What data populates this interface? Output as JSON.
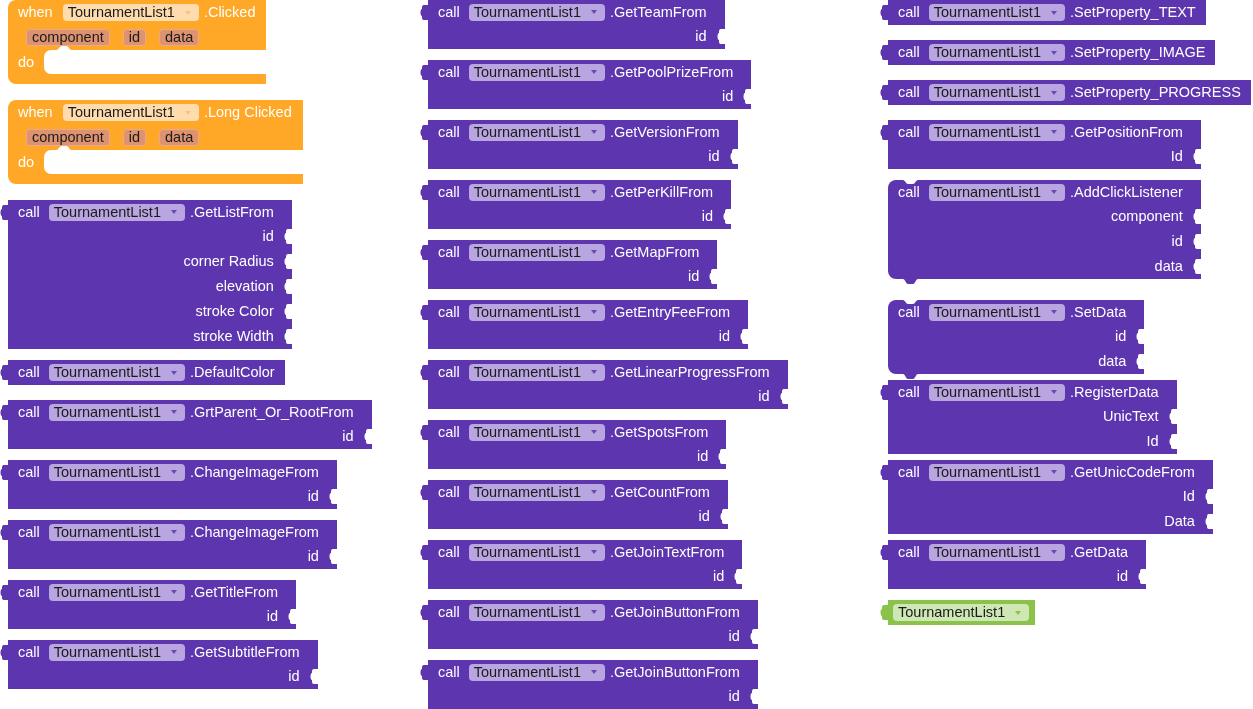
{
  "workspace": {
    "columns": [
      {
        "blocks": [
          {
            "kind": "event",
            "keyword": "when",
            "component": "TournamentList1",
            "event": ".Clicked",
            "params": [
              "component",
              "id",
              "data"
            ],
            "do_label": "do"
          },
          {
            "kind": "event",
            "keyword": "when",
            "component": "TournamentList1",
            "event": ".Long Clicked",
            "params": [
              "component",
              "id",
              "data"
            ],
            "do_label": "do"
          },
          {
            "kind": "value_call",
            "keyword": "call",
            "component": "TournamentList1",
            "method": ".GetListFrom",
            "inputs": [
              "id",
              "corner Radius",
              "elevation",
              "stroke Color",
              "stroke Width"
            ]
          },
          {
            "kind": "value_call",
            "keyword": "call",
            "component": "TournamentList1",
            "method": ".DefaultColor"
          },
          {
            "kind": "value_call",
            "keyword": "call",
            "component": "TournamentList1",
            "method": ".GrtParent_Or_RootFrom",
            "inputs": [
              "id"
            ]
          },
          {
            "kind": "value_call",
            "keyword": "call",
            "component": "TournamentList1",
            "method": ".ChangeImageFrom",
            "inputs": [
              "id"
            ]
          },
          {
            "kind": "value_call",
            "keyword": "call",
            "component": "TournamentList1",
            "method": ".ChangeImageFrom",
            "inputs": [
              "id"
            ]
          },
          {
            "kind": "value_call",
            "keyword": "call",
            "component": "TournamentList1",
            "method": ".GetTitleFrom",
            "inputs": [
              "id"
            ]
          },
          {
            "kind": "value_call",
            "keyword": "call",
            "component": "TournamentList1",
            "method": ".GetSubtitleFrom",
            "inputs": [
              "id"
            ]
          }
        ]
      },
      {
        "blocks": [
          {
            "kind": "value_call",
            "keyword": "call",
            "component": "TournamentList1",
            "method": ".GetTeamFrom",
            "inputs": [
              "id"
            ]
          },
          {
            "kind": "value_call",
            "keyword": "call",
            "component": "TournamentList1",
            "method": ".GetPoolPrizeFrom",
            "inputs": [
              "id"
            ]
          },
          {
            "kind": "value_call",
            "keyword": "call",
            "component": "TournamentList1",
            "method": ".GetVersionFrom",
            "inputs": [
              "id"
            ]
          },
          {
            "kind": "value_call",
            "keyword": "call",
            "component": "TournamentList1",
            "method": ".GetPerKillFrom",
            "inputs": [
              "id"
            ]
          },
          {
            "kind": "value_call",
            "keyword": "call",
            "component": "TournamentList1",
            "method": ".GetMapFrom",
            "inputs": [
              "id"
            ]
          },
          {
            "kind": "value_call",
            "keyword": "call",
            "component": "TournamentList1",
            "method": ".GetEntryFeeFrom",
            "inputs": [
              "id"
            ]
          },
          {
            "kind": "value_call",
            "keyword": "call",
            "component": "TournamentList1",
            "method": ".GetLinearProgressFrom",
            "inputs": [
              "id"
            ]
          },
          {
            "kind": "value_call",
            "keyword": "call",
            "component": "TournamentList1",
            "method": ".GetSpotsFrom",
            "inputs": [
              "id"
            ]
          },
          {
            "kind": "value_call",
            "keyword": "call",
            "component": "TournamentList1",
            "method": ".GetCountFrom",
            "inputs": [
              "id"
            ]
          },
          {
            "kind": "value_call",
            "keyword": "call",
            "component": "TournamentList1",
            "method": ".GetJoinTextFrom",
            "inputs": [
              "id"
            ]
          },
          {
            "kind": "value_call",
            "keyword": "call",
            "component": "TournamentList1",
            "method": ".GetJoinButtonFrom",
            "inputs": [
              "id"
            ]
          },
          {
            "kind": "value_call",
            "keyword": "call",
            "component": "TournamentList1",
            "method": ".GetJoinButtonFrom",
            "inputs": [
              "id"
            ]
          }
        ]
      },
      {
        "blocks": [
          {
            "kind": "value_call",
            "keyword": "call",
            "component": "TournamentList1",
            "method": ".SetProperty_TEXT"
          },
          {
            "kind": "value_call",
            "keyword": "call",
            "component": "TournamentList1",
            "method": ".SetProperty_IMAGE"
          },
          {
            "kind": "value_call",
            "keyword": "call",
            "component": "TournamentList1",
            "method": ".SetProperty_PROGRESS"
          },
          {
            "kind": "value_call",
            "keyword": "call",
            "component": "TournamentList1",
            "method": ".GetPositionFrom",
            "inputs": [
              "Id"
            ]
          },
          {
            "kind": "statement_call",
            "keyword": "call",
            "component": "TournamentList1",
            "method": ".AddClickListener",
            "inputs": [
              "component",
              "id",
              "data"
            ]
          },
          {
            "kind": "statement_call",
            "keyword": "call",
            "component": "TournamentList1",
            "method": ".SetData",
            "inputs": [
              "id",
              "data"
            ]
          },
          {
            "kind": "value_call",
            "keyword": "call",
            "component": "TournamentList1",
            "method": ".RegisterData",
            "inputs": [
              "UnicText",
              "Id"
            ]
          },
          {
            "kind": "value_call",
            "keyword": "call",
            "component": "TournamentList1",
            "method": ".GetUnicCodeFrom",
            "inputs": [
              "Id",
              "Data"
            ]
          },
          {
            "kind": "value_call",
            "keyword": "call",
            "component": "TournamentList1",
            "method": ".GetData",
            "inputs": [
              "id"
            ]
          },
          {
            "kind": "component",
            "component": "TournamentList1"
          }
        ]
      }
    ]
  }
}
